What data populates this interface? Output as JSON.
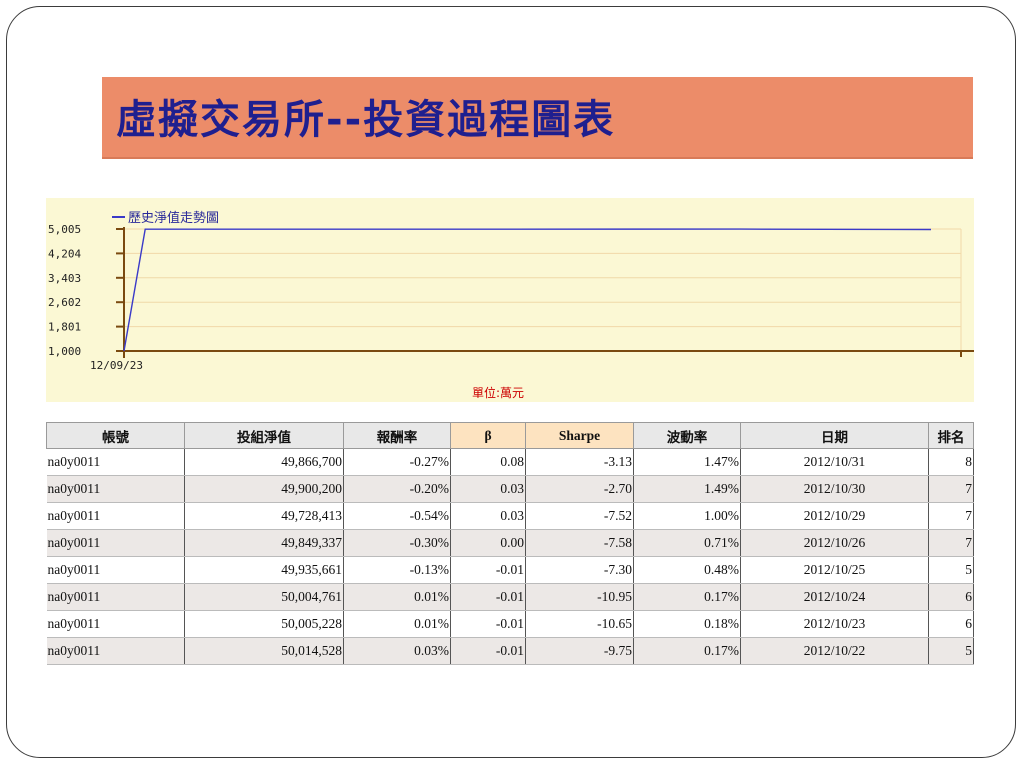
{
  "slide": {
    "title": "虛擬交易所--投資過程圖表"
  },
  "chart": {
    "legend": "歷史淨值走勢圖",
    "unit_label": "單位:萬元",
    "colors": {
      "line": "#3a3ac8",
      "axis": "#7a4a10",
      "grid": "#f0d9a8",
      "background": "#fbf8d4"
    }
  },
  "chart_data": {
    "type": "line",
    "title": "",
    "legend": [
      "歷史淨值走勢圖"
    ],
    "series": [
      {
        "name": "歷史淨值走勢圖",
        "x": [
          "12/09/23",
          "12/09/24",
          "12/10/22",
          "12/10/31"
        ],
        "values": [
          1000,
          5000,
          5001,
          4987
        ]
      }
    ],
    "x_tick_labels": [
      "12/09/23"
    ],
    "y_tick_labels": [
      "5,005",
      "4,204",
      "3,403",
      "2,602",
      "1,801",
      "1,000"
    ],
    "ylim": [
      1000,
      5005
    ],
    "unit": "單位:萬元",
    "grid": true,
    "legend_position": "top-left"
  },
  "table": {
    "headers": [
      "帳號",
      "投組淨值",
      "報酬率",
      "β",
      "Sharpe",
      "波動率",
      "日期",
      "排名"
    ],
    "rows": [
      [
        "na0y0011",
        "49,866,700",
        "-0.27%",
        "0.08",
        "-3.13",
        "1.47%",
        "2012/10/31",
        "8"
      ],
      [
        "na0y0011",
        "49,900,200",
        "-0.20%",
        "0.03",
        "-2.70",
        "1.49%",
        "2012/10/30",
        "7"
      ],
      [
        "na0y0011",
        "49,728,413",
        "-0.54%",
        "0.03",
        "-7.52",
        "1.00%",
        "2012/10/29",
        "7"
      ],
      [
        "na0y0011",
        "49,849,337",
        "-0.30%",
        "0.00",
        "-7.58",
        "0.71%",
        "2012/10/26",
        "7"
      ],
      [
        "na0y0011",
        "49,935,661",
        "-0.13%",
        "-0.01",
        "-7.30",
        "0.48%",
        "2012/10/25",
        "5"
      ],
      [
        "na0y0011",
        "50,004,761",
        "0.01%",
        "-0.01",
        "-10.95",
        "0.17%",
        "2012/10/24",
        "6"
      ],
      [
        "na0y0011",
        "50,005,228",
        "0.01%",
        "-0.01",
        "-10.65",
        "0.18%",
        "2012/10/23",
        "6"
      ],
      [
        "na0y0011",
        "50,014,528",
        "0.03%",
        "-0.01",
        "-9.75",
        "0.17%",
        "2012/10/22",
        "5"
      ]
    ]
  }
}
